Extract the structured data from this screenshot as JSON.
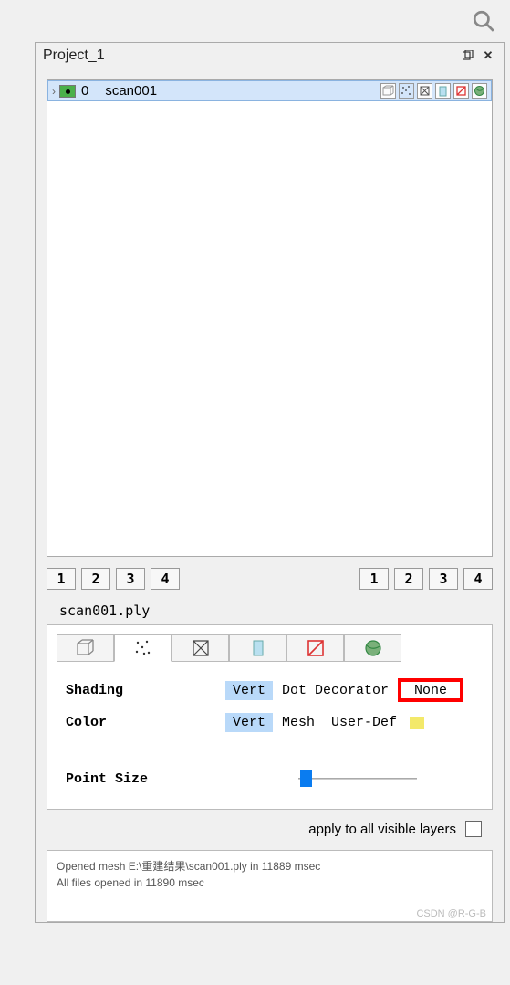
{
  "header": {
    "title": "Project_1"
  },
  "tree": {
    "items": [
      {
        "index": "0",
        "name": "scan001"
      }
    ]
  },
  "pages_left": [
    "1",
    "2",
    "3",
    "4"
  ],
  "pages_right": [
    "1",
    "2",
    "3",
    "4"
  ],
  "properties": {
    "filename": "scan001.ply",
    "shading": {
      "label": "Shading",
      "options": [
        "Vert",
        "Dot Decorator",
        "None"
      ],
      "selected": "Vert"
    },
    "color": {
      "label": "Color",
      "options": [
        "Vert",
        "Mesh",
        "User-Def"
      ],
      "selected": "Vert"
    },
    "point_size": {
      "label": "Point Size"
    },
    "apply_label": "apply to all visible layers"
  },
  "log": {
    "lines": [
      "Opened mesh E:\\重建结果\\scan001.ply in 11889 msec",
      "All files opened in 11890 msec"
    ]
  },
  "watermark": "CSDN @R-G-B"
}
